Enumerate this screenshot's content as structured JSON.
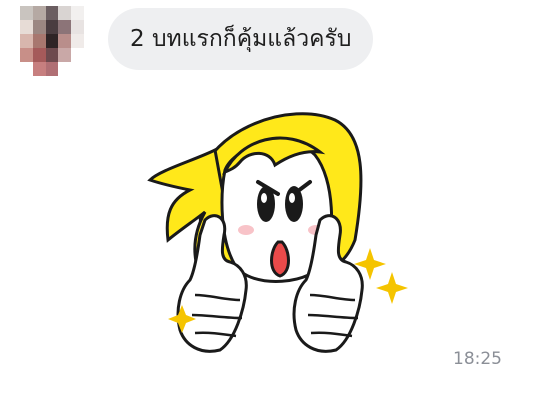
{
  "chat": {
    "message": {
      "text": "2 บทแรกก็คุ้มแล้วครับ"
    },
    "sticker": {
      "icon": "brown-cony-sally-sticker-thumbs-up"
    },
    "timestamp": "18:25"
  },
  "colors": {
    "bubble_bg": "#eeeff1",
    "time": "#8b8f97",
    "sticker_hair": "#ffe81a"
  }
}
